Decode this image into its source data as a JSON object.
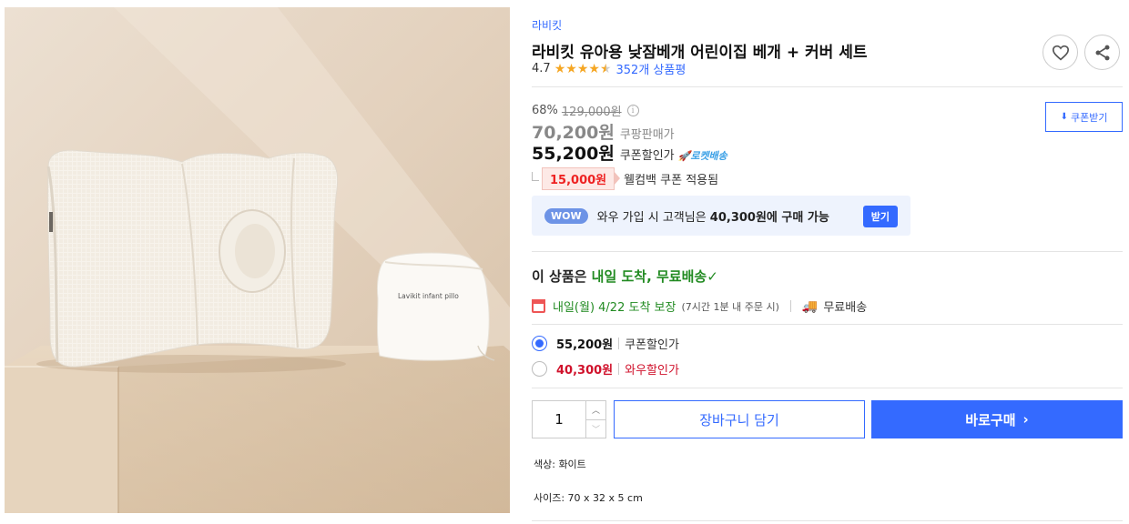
{
  "image": {
    "alt": "",
    "colors": {
      "background": "#e6d3bf",
      "pillow": "#f6f2ea",
      "pouch": "#fbf9f5"
    },
    "pouch_text": "Lavikit infant pillo"
  },
  "product": {
    "brand": "라비킷",
    "title": "라비킷 유아용 낮잠베개 어린이집 베개 + 커버 세트",
    "rating": "4.7",
    "rating_value": 4.7,
    "review_count": "352개 상품평"
  },
  "actions": {
    "wishlist_icon": "heart-icon",
    "share_icon": "share-icon"
  },
  "price": {
    "discount_rate": "68%",
    "original_price": "129,000원",
    "info_symbol": "i",
    "sale_price": "70,200원",
    "sale_label": "쿠팡판매가",
    "coupon_price": "55,200원",
    "coupon_label": "쿠폰할인가",
    "rocket_label": "🚀로켓배송",
    "welcome_coupon_amount": "15,000원",
    "welcome_coupon_text": "웰컴백 쿠폰 적용됨",
    "coupon_button": "쿠폰받기"
  },
  "wow": {
    "badge": "WOW",
    "text_prefix": "와우 가입 시 고객님은 ",
    "text_price": "40,300원에 구매 가능",
    "button": "받기"
  },
  "delivery": {
    "head_prefix": "이 상품은 ",
    "head_highlight": "내일 도착, 무료배송",
    "check": "✓",
    "arrival": "내일(월) 4/22 도착 보장",
    "arrival_note": "(7시간 1분 내 주문 시)",
    "free_shipping": "무료배송"
  },
  "options": [
    {
      "price": "55,200원",
      "label": "쿠폰할인가",
      "selected": true
    },
    {
      "price": "40,300원",
      "label": "와우할인가",
      "selected": false
    }
  ],
  "purchase": {
    "quantity": "1",
    "up_symbol": "︿",
    "down_symbol": "﹀",
    "cart_button": "장바구니 담기",
    "buy_button": "바로구매",
    "buy_chevron": "›"
  },
  "specs": [
    "색상: 화이트",
    "사이즈: 70 x 32 x 5 cm"
  ],
  "theme": {
    "accent": "#346aff",
    "green": "#228b22",
    "red": "#d0112b",
    "star": "#f5a623"
  }
}
